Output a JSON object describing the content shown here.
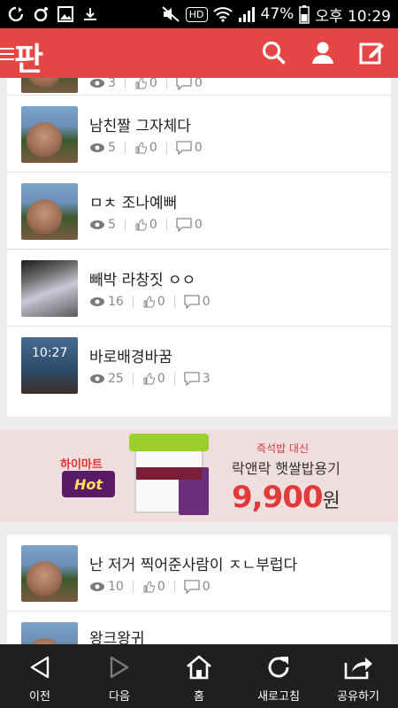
{
  "status_bar": {
    "battery": "47%",
    "time": "오후 10:29",
    "hd": "HD"
  },
  "app": {
    "logo": "판",
    "colors": {
      "accent": "#e64545",
      "nav_bg": "#1f1f1f"
    }
  },
  "posts": [
    {
      "title": "",
      "views": "3",
      "likes": "0",
      "comments": "0"
    },
    {
      "title": "남친짤 그자체다",
      "views": "5",
      "likes": "0",
      "comments": "0"
    },
    {
      "title": "ㅁㅊ 조나예뻐",
      "views": "5",
      "likes": "0",
      "comments": "0"
    },
    {
      "title": "빼박 라창짓 ㅇㅇ",
      "views": "16",
      "likes": "0",
      "comments": "0"
    },
    {
      "title": "바로배경바꿈",
      "views": "25",
      "likes": "0",
      "comments": "3"
    },
    {
      "title": "난 저거 찍어준사람이 ㅈㄴ부럽다",
      "views": "10",
      "likes": "0",
      "comments": "0"
    },
    {
      "title": "왕크왕귀",
      "views": "",
      "likes": "",
      "comments": ""
    }
  ],
  "thumb_lock_time": "10:27",
  "ad": {
    "brand": "하이마트",
    "brand_logo": "Hot",
    "subtitle": "즉석밥 대신",
    "product_name": "락앤락 햇쌀밥용기",
    "price": "9,900",
    "price_unit": "원"
  },
  "bottom_nav": {
    "back": "이전",
    "forward": "다음",
    "home": "홈",
    "refresh": "새로고침",
    "share": "공유하기"
  }
}
